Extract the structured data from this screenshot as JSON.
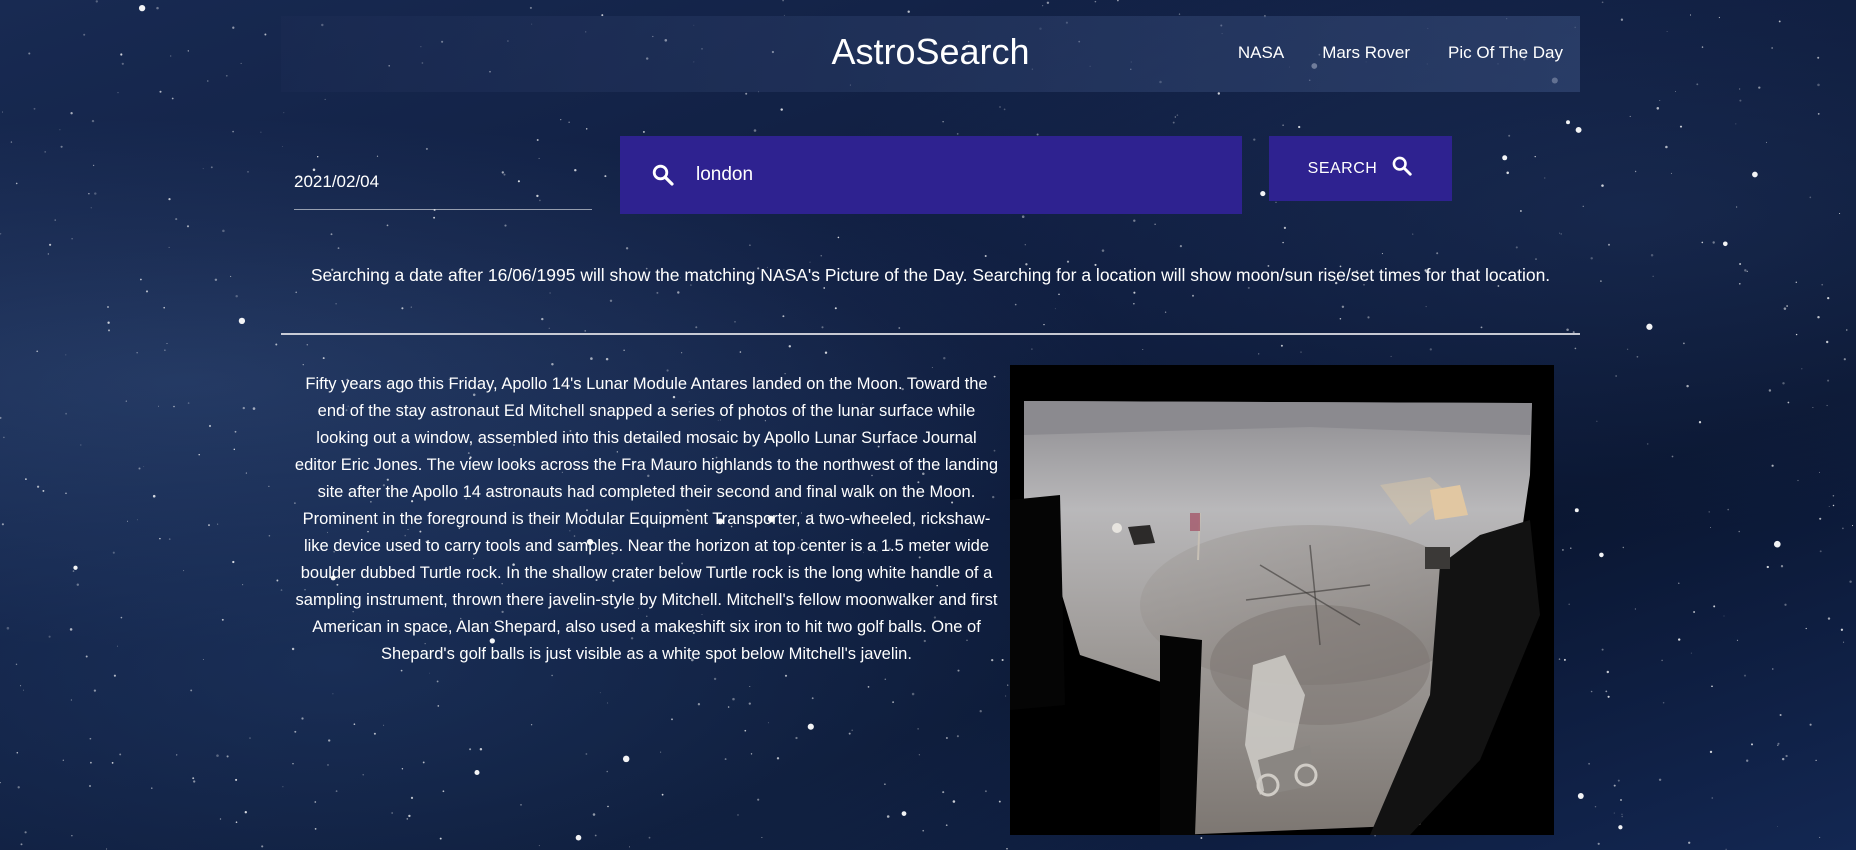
{
  "header": {
    "title": "AstroSearch",
    "nav": [
      {
        "label": "NASA"
      },
      {
        "label": "Mars Rover"
      },
      {
        "label": "Pic Of The Day"
      }
    ]
  },
  "search": {
    "date_value": "2021/02/04",
    "location_value": "london",
    "button_label": "SEARCH"
  },
  "help_text": "Searching a date after 16/06/1995 will show the matching NASA's Picture of the Day. Searching for a location will show moon/sun rise/set times for that location.",
  "apod": {
    "description": "Fifty years ago this Friday, Apollo 14's Lunar Module Antares landed on the Moon. Toward the end of the stay astronaut Ed Mitchell snapped a series of photos of the lunar surface while looking out a window, assembled into this detailed mosaic by Apollo Lunar Surface Journal editor Eric Jones. The view looks across the Fra Mauro highlands to the northwest of the landing site after the Apollo 14 astronauts had completed their second and final walk on the Moon. Prominent in the foreground is their Modular Equipment Transporter, a two-wheeled, rickshaw-like device used to carry tools and samples. Near the horizon at top center is a 1.5 meter wide boulder dubbed Turtle rock. In the shallow crater below Turtle rock is the long white handle of a sampling instrument, thrown there javelin-style by Mitchell. Mitchell's fellow moonwalker and first American in space, Alan Shepard, also used a makeshift six iron to hit two golf balls. One of Shepard's golf balls is just visible as a white spot below Mitchell's javelin."
  },
  "colors": {
    "accent": "#2e2290",
    "background": "#0f1d3f",
    "text": "#ffffff"
  },
  "icons": {
    "search_field": "search-icon",
    "search_button": "search-icon"
  }
}
